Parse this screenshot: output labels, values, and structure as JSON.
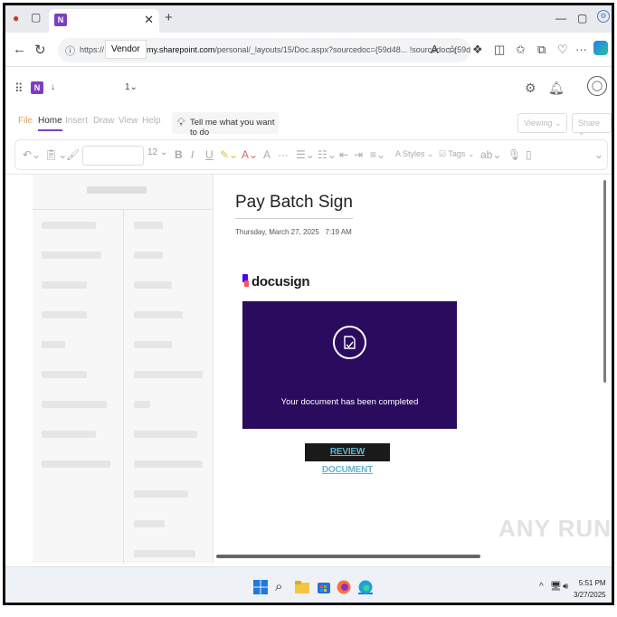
{
  "browser": {
    "tab_close": "✕",
    "new_tab": "+",
    "address": {
      "protocol": "https://",
      "vendor_overlay": "Vendor",
      "host": "my.sharepoint.com",
      "path": "/personal/_layouts/15/Doc.aspx?sourcedoc={59d48...",
      "path_tail": "!sourcedoc={59d48..."
    }
  },
  "app": {
    "notebook_marker": "↓",
    "section_marker": "1⌄"
  },
  "ribbon": {
    "tabs": [
      "File",
      "Home",
      "Insert",
      "Draw",
      "View",
      "Help"
    ],
    "active_tab": "Home",
    "tell_me": "Tell me what you want to do",
    "viewing": "Viewing ⌄",
    "share": "Share ⌄"
  },
  "toolbar": {
    "font_size": "12",
    "styles": "Styles",
    "tags": "Tags"
  },
  "page": {
    "title": "Pay Batch Sign",
    "date": "Thursday, March 27, 2025",
    "time": "7:19 AM"
  },
  "docusign": {
    "brand": "docusign",
    "banner_text": "Your document has been completed",
    "button_label": "REVIEW DOCUMENT",
    "banner_color": "#2a0b5e"
  },
  "watermark": "ANY RUN",
  "taskbar": {
    "time": "5:51 PM",
    "date": "3/27/2025"
  }
}
